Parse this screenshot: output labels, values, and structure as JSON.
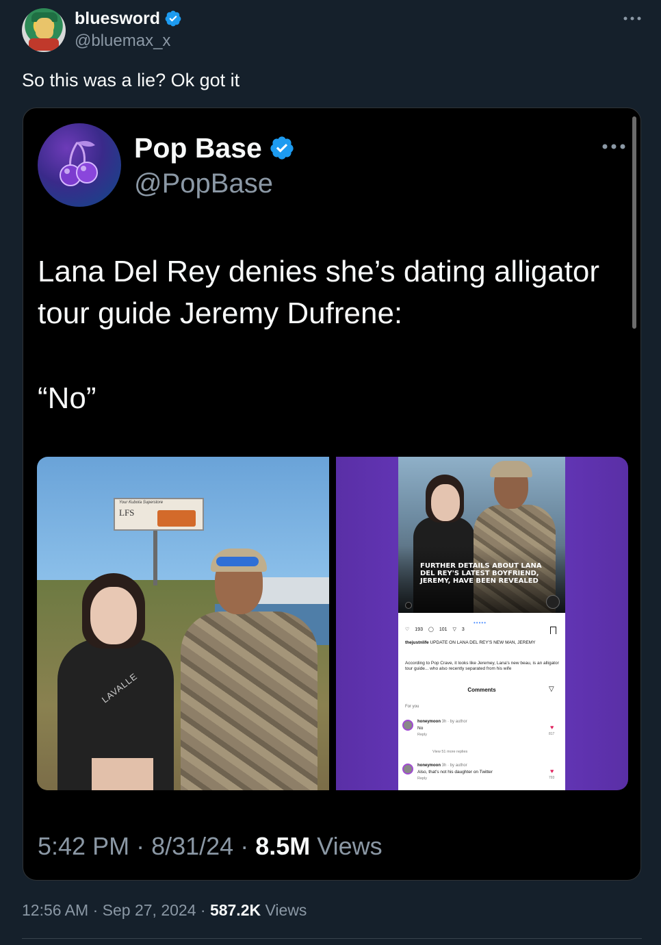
{
  "author": {
    "display_name": "bluesword",
    "handle": "@bluemax_x",
    "verified": true,
    "avatar_icon": "avatar-image"
  },
  "tweet_text": "So this was a lie? Ok got it",
  "quoted": {
    "display_name": "Pop Base",
    "handle": "@PopBase",
    "verified": true,
    "avatar_icon": "cherry-icon",
    "text": "Lana Del Rey denies she’s dating alligator tour guide Jeremy Dufrene:",
    "quote": "“No”",
    "time": "5:42 PM",
    "date": "8/31/24",
    "views_count": "8.5M",
    "views_label": "Views",
    "media": {
      "left_photo": {
        "billboard_brand": "LFS",
        "billboard_small": "Your Kubota Superstore",
        "shirt_text": "LAVALLE"
      },
      "right_screenshot": {
        "headline": "FURTHER DETAILS ABOUT LANA DEL REY'S LATEST BOYFRIEND, JEREMY, HAVE BEEN REVEALED",
        "likes": "193",
        "comments_count": "101",
        "shares": "3",
        "caption_user": "thejustnlife",
        "caption_text": "UPDATE ON LANA DEL REY'S NEW MAN, JEREMY",
        "body_text": "According to Pop Crave, it looks like Jeremey, Lana's new beau, is an alligator tour guide... who also recently separated from his wife",
        "comments_title": "Comments",
        "for_you": "For you",
        "comment1": {
          "user": "honeymoon",
          "meta": "3h · by author",
          "text": "No",
          "reply": "Reply",
          "likes": "817"
        },
        "view_more": "View 51 more replies",
        "comment2": {
          "user": "honeymoon",
          "meta": "3h · by author",
          "text": "Also, that's not his daughter on Twitter",
          "reply": "Reply",
          "likes": "793"
        }
      }
    }
  },
  "time": "12:56 AM",
  "date": "Sep 27, 2024",
  "views_count": "587.2K",
  "views_label": "Views",
  "colors": {
    "background": "#15202b",
    "card": "#000000",
    "text_primary": "#f7f9f9",
    "text_secondary": "#8b98a5",
    "verified_blue": "#1d9bf0"
  }
}
